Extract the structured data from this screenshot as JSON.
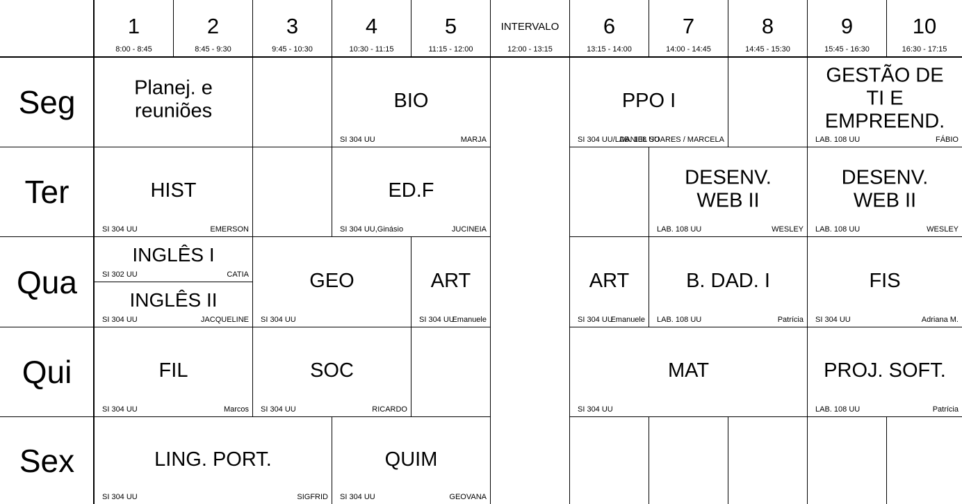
{
  "interval": {
    "label": "INTERVALO",
    "time": "12:00 - 13:15"
  },
  "periods": [
    {
      "num": "1",
      "time": "8:00 - 8:45"
    },
    {
      "num": "2",
      "time": "8:45 - 9:30"
    },
    {
      "num": "3",
      "time": "9:45 - 10:30"
    },
    {
      "num": "4",
      "time": "10:30 - 11:15"
    },
    {
      "num": "5",
      "time": "11:15 - 12:00"
    },
    {
      "num": "6",
      "time": "13:15 - 14:00"
    },
    {
      "num": "7",
      "time": "14:00 - 14:45"
    },
    {
      "num": "8",
      "time": "14:45 - 15:30"
    },
    {
      "num": "9",
      "time": "15:45 - 16:30"
    },
    {
      "num": "10",
      "time": "16:30 - 17:15"
    }
  ],
  "days": [
    "Seg",
    "Ter",
    "Qua",
    "Qui",
    "Sex"
  ],
  "classes": [
    {
      "day": 0,
      "start": 1,
      "span": 2,
      "subject": "Planej. e\nreuniões",
      "room": "",
      "teacher": ""
    },
    {
      "day": 0,
      "start": 4,
      "span": 2,
      "subject": "BIO",
      "room": "SI 304 UU",
      "teacher": "MARJA"
    },
    {
      "day": 0,
      "start": 6,
      "span": 2,
      "subject": "PPO I",
      "room": "SI 304 UU/LAB. 108 UU",
      "teacher": "DANIEL SOARES / MARCELA"
    },
    {
      "day": 0,
      "start": 9,
      "span": 2,
      "subject": "GESTÃO DE\nTI E\nEMPREEND.",
      "room": "LAB. 108 UU",
      "teacher": "FÁBIO"
    },
    {
      "day": 1,
      "start": 1,
      "span": 2,
      "subject": "HIST",
      "room": "SI 304 UU",
      "teacher": "EMERSON"
    },
    {
      "day": 1,
      "start": 4,
      "span": 2,
      "subject": "ED.F",
      "room": "SI 304 UU,Ginásio",
      "teacher": "JUCINEIA"
    },
    {
      "day": 1,
      "start": 7,
      "span": 2,
      "subject": "DESENV.\nWEB II",
      "room": "LAB. 108 UU",
      "teacher": "WESLEY"
    },
    {
      "day": 1,
      "start": 9,
      "span": 2,
      "subject": "DESENV.\nWEB II",
      "room": "LAB. 108 UU",
      "teacher": "WESLEY"
    },
    {
      "day": 2,
      "start": 1,
      "span": 2,
      "half": "top",
      "subject": "INGLÊS I",
      "room": "SI 302 UU",
      "teacher": "CATIA"
    },
    {
      "day": 2,
      "start": 1,
      "span": 2,
      "half": "bottom",
      "subject": "INGLÊS II",
      "room": "SI 304 UU",
      "teacher": "JACQUELINE"
    },
    {
      "day": 2,
      "start": 3,
      "span": 2,
      "subject": "GEO",
      "room": "SI 304 UU",
      "teacher": ""
    },
    {
      "day": 2,
      "start": 5,
      "span": 1,
      "subject": "ART",
      "room": "SI 304 UU",
      "teacher": "Emanuele"
    },
    {
      "day": 2,
      "start": 6,
      "span": 1,
      "subject": "ART",
      "room": "SI 304 UU",
      "teacher": "Emanuele"
    },
    {
      "day": 2,
      "start": 7,
      "span": 2,
      "subject": "B. DAD. I",
      "room": "LAB. 108 UU",
      "teacher": "Patrícia"
    },
    {
      "day": 2,
      "start": 9,
      "span": 2,
      "subject": "FIS",
      "room": "SI 304 UU",
      "teacher": "Adriana M."
    },
    {
      "day": 3,
      "start": 1,
      "span": 2,
      "subject": "FIL",
      "room": "SI 304 UU",
      "teacher": "Marcos"
    },
    {
      "day": 3,
      "start": 3,
      "span": 2,
      "subject": "SOC",
      "room": "SI 304 UU",
      "teacher": "RICARDO"
    },
    {
      "day": 3,
      "start": 6,
      "span": 3,
      "subject": "MAT",
      "room": "SI 304 UU",
      "teacher": ""
    },
    {
      "day": 3,
      "start": 9,
      "span": 2,
      "subject": "PROJ. SOFT.",
      "room": "LAB. 108 UU",
      "teacher": "Patrícia"
    },
    {
      "day": 4,
      "start": 1,
      "span": 3,
      "subject": "LING. PORT.",
      "room": "SI 304 UU",
      "teacher": "SIGFRID"
    },
    {
      "day": 4,
      "start": 4,
      "span": 2,
      "subject": "QUIM",
      "room": "SI 304 UU",
      "teacher": "GEOVANA"
    }
  ],
  "empty": [
    {
      "day": 0,
      "start": 3
    },
    {
      "day": 0,
      "start": 8
    },
    {
      "day": 1,
      "start": 3
    },
    {
      "day": 1,
      "start": 6
    },
    {
      "day": 3,
      "start": 5
    },
    {
      "day": 4,
      "start": 6
    },
    {
      "day": 4,
      "start": 7
    },
    {
      "day": 4,
      "start": 8
    },
    {
      "day": 4,
      "start": 9
    },
    {
      "day": 4,
      "start": 10
    }
  ]
}
